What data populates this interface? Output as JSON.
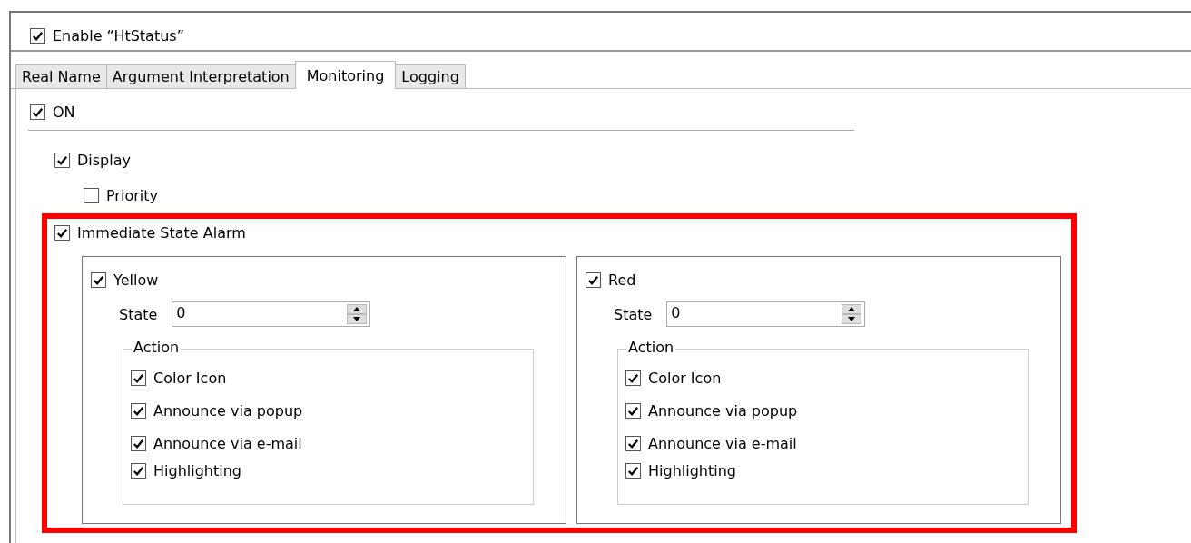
{
  "enable": {
    "label": "Enable “HtStatus”",
    "checked": true
  },
  "tabs": [
    {
      "label": "Real Name",
      "selected": false
    },
    {
      "label": "Argument Interpretation",
      "selected": false
    },
    {
      "label": "Monitoring",
      "selected": true
    },
    {
      "label": "Logging",
      "selected": false
    }
  ],
  "monitoring": {
    "on": {
      "label": "ON",
      "checked": true
    },
    "display": {
      "label": "Display",
      "checked": true
    },
    "priority": {
      "label": "Priority",
      "checked": false
    },
    "immediate_alarm": {
      "label": "Immediate State Alarm",
      "checked": true
    },
    "levels": [
      {
        "label": "Yellow",
        "checked": true,
        "state_label": "State",
        "state_value": "0",
        "action_title": "Action",
        "actions": [
          {
            "label": "Color Icon",
            "checked": true
          },
          {
            "label": "Announce via popup",
            "checked": true
          },
          {
            "label": "Announce via e-mail",
            "checked": true
          },
          {
            "label": "Highlighting",
            "checked": true
          }
        ]
      },
      {
        "label": "Red",
        "checked": true,
        "state_label": "State",
        "state_value": "0",
        "action_title": "Action",
        "actions": [
          {
            "label": "Color Icon",
            "checked": true
          },
          {
            "label": "Announce via popup",
            "checked": true
          },
          {
            "label": "Announce via e-mail",
            "checked": true
          },
          {
            "label": "Highlighting",
            "checked": true
          }
        ]
      }
    ]
  }
}
